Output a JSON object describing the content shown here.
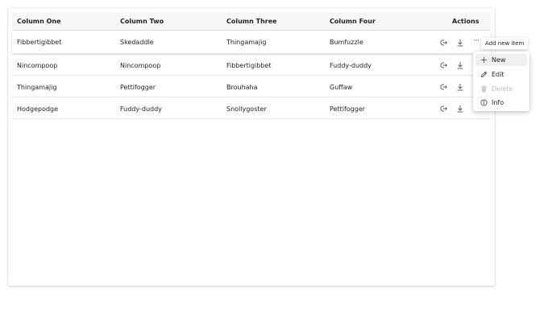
{
  "table": {
    "headers": [
      "Column One",
      "Column Two",
      "Column Three",
      "Column Four",
      "Actions"
    ],
    "rows": [
      [
        "Fibbertigibbet",
        "Skedaddle",
        "Thingamajig",
        "Bumfuzzle"
      ],
      [
        "Nincompoop",
        "Nincompoop",
        "Fibbertigibbet",
        "Fuddy-duddy"
      ],
      [
        "Thingamajig",
        "Pettifogger",
        "Brouhaha",
        "Guffaw"
      ],
      [
        "Hodgepodge",
        "Fuddy-duddy",
        "Snollygoster",
        "Pettifogger"
      ]
    ]
  },
  "row_actions": {
    "icons": [
      "share-icon",
      "download-icon",
      "more-icon"
    ]
  },
  "tooltip": {
    "text": "Add new item"
  },
  "menu": {
    "items": [
      {
        "label": "New",
        "icon": "plus-icon",
        "state": "hover"
      },
      {
        "label": "Edit",
        "icon": "pencil-icon",
        "state": "enabled"
      },
      {
        "label": "Delete",
        "icon": "trash-icon",
        "state": "disabled"
      },
      {
        "label": "Info",
        "icon": "info-icon",
        "state": "enabled"
      }
    ]
  },
  "colors": {
    "header_bg": "#f7f7f7",
    "border": "#e6e6e6",
    "text": "#242424",
    "disabled_text": "#bdbdbd",
    "hover_bg": "#f0f0f0"
  }
}
